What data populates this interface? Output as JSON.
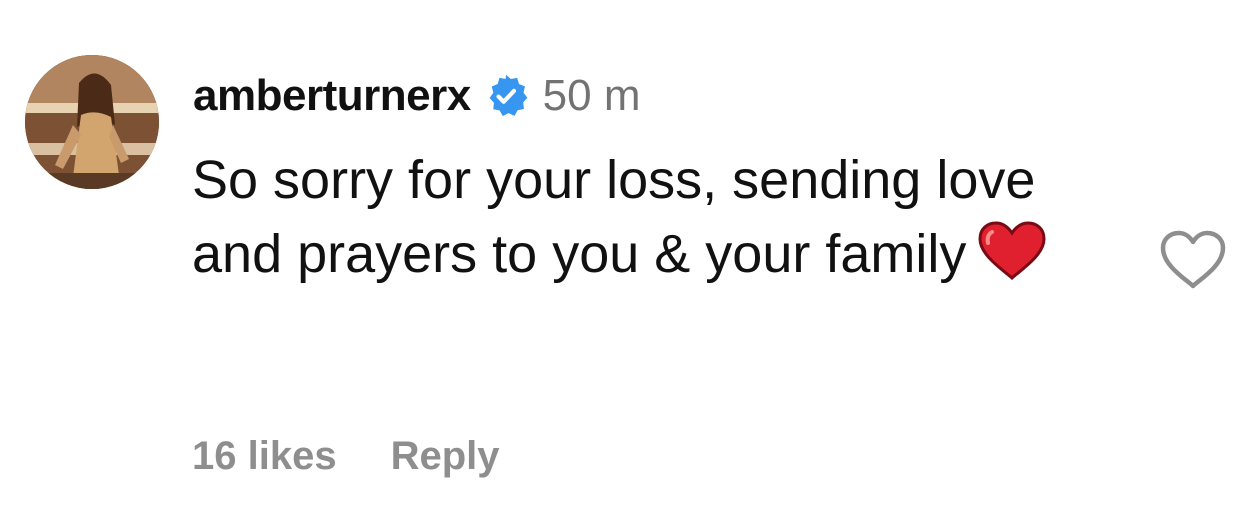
{
  "comment": {
    "username": "amberturnerx",
    "verified": true,
    "timestamp": "50 m",
    "text": "So sorry for your loss, sending love and prayers to you & your family",
    "emoji": "red-heart",
    "likes_label": "16 likes",
    "reply_label": "Reply"
  },
  "icons": {
    "avatar": "profile-photo",
    "verified_badge": "verified-badge-icon",
    "like": "heart-outline-icon",
    "emoji": "red-heart-emoji"
  },
  "colors": {
    "text_primary": "#111111",
    "text_secondary": "#737373",
    "text_muted": "#8e8e8e",
    "verified_blue": "#3797f0",
    "heart_red": "#e0202f",
    "heart_outline": "#8e8e8e"
  }
}
